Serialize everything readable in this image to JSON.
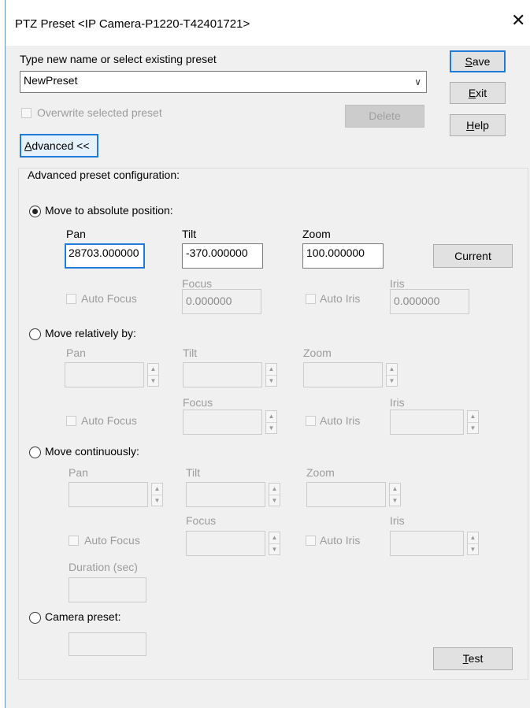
{
  "window": {
    "title": "PTZ Preset <IP Camera-P1220-T42401721>",
    "close_glyph": "✕"
  },
  "preset": {
    "prompt": "Type new name or select existing preset",
    "name_value": "NewPreset",
    "overwrite_label": "Overwrite selected preset",
    "delete_label": "Delete",
    "advanced_label": "Advanced <<"
  },
  "side_buttons": {
    "save": "Save",
    "exit": "Exit",
    "help": "Help"
  },
  "advanced": {
    "group_title": "Advanced preset configuration:",
    "absolute": {
      "label": "Move to absolute position:",
      "selected": true,
      "pan_label": "Pan",
      "tilt_label": "Tilt",
      "zoom_label": "Zoom",
      "pan_value": "28703.000000",
      "tilt_value": "-370.000000",
      "zoom_value": "100.000000",
      "current_label": "Current",
      "focus_label": "Focus",
      "iris_label": "Iris",
      "auto_focus_label": "Auto Focus",
      "auto_iris_label": "Auto Iris",
      "focus_value": "0.000000",
      "iris_value": "0.000000"
    },
    "relative": {
      "label": "Move relatively by:",
      "pan_label": "Pan",
      "tilt_label": "Tilt",
      "zoom_label": "Zoom",
      "focus_label": "Focus",
      "iris_label": "Iris",
      "auto_focus_label": "Auto Focus",
      "auto_iris_label": "Auto Iris"
    },
    "continuous": {
      "label": "Move continuously:",
      "pan_label": "Pan",
      "tilt_label": "Tilt",
      "zoom_label": "Zoom",
      "focus_label": "Focus",
      "iris_label": "Iris",
      "auto_focus_label": "Auto Focus",
      "auto_iris_label": "Auto Iris",
      "duration_label": "Duration (sec)"
    },
    "camera_preset": {
      "label": "Camera preset:"
    },
    "test_label": "Test"
  },
  "colors": {
    "focus_border": "#1e7bd8",
    "dialog_bg": "#f0f0f0",
    "disabled_text": "#9c9c9c"
  }
}
